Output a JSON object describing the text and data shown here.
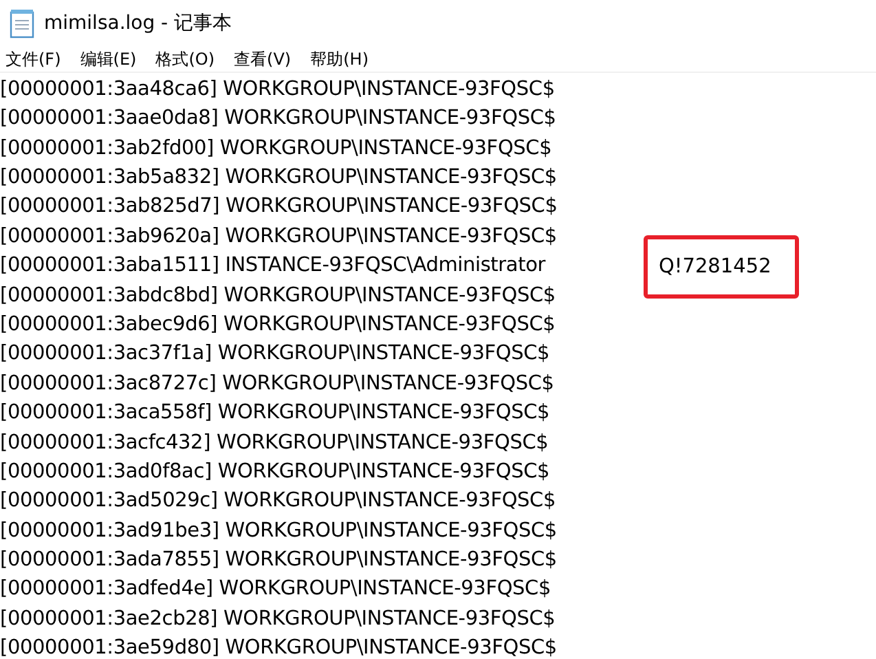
{
  "window": {
    "title": "mimilsa.log - 记事本"
  },
  "menu": [
    "文件(F)",
    "编辑(E)",
    "格式(O)",
    "查看(V)",
    "帮助(H)"
  ],
  "lines": [
    {
      "text": "[00000001:3aa48ca6] WORKGROUP\\INSTANCE-93FQSC$"
    },
    {
      "text": "[00000001:3aae0da8] WORKGROUP\\INSTANCE-93FQSC$"
    },
    {
      "text": "[00000001:3ab2fd00] WORKGROUP\\INSTANCE-93FQSC$"
    },
    {
      "text": "[00000001:3ab5a832] WORKGROUP\\INSTANCE-93FQSC$"
    },
    {
      "text": "[00000001:3ab825d7] WORKGROUP\\INSTANCE-93FQSC$"
    },
    {
      "text": "[00000001:3ab9620a] WORKGROUP\\INSTANCE-93FQSC$"
    },
    {
      "text": "[00000001:3aba1511] INSTANCE-93FQSC\\Administrator",
      "highlighted_note": "Q!7281452"
    },
    {
      "text": "[00000001:3abdc8bd] WORKGROUP\\INSTANCE-93FQSC$"
    },
    {
      "text": "[00000001:3abec9d6] WORKGROUP\\INSTANCE-93FQSC$"
    },
    {
      "text": "[00000001:3ac37f1a] WORKGROUP\\INSTANCE-93FQSC$"
    },
    {
      "text": "[00000001:3ac8727c] WORKGROUP\\INSTANCE-93FQSC$"
    },
    {
      "text": "[00000001:3aca558f] WORKGROUP\\INSTANCE-93FQSC$"
    },
    {
      "text": "[00000001:3acfc432] WORKGROUP\\INSTANCE-93FQSC$"
    },
    {
      "text": "[00000001:3ad0f8ac] WORKGROUP\\INSTANCE-93FQSC$"
    },
    {
      "text": "[00000001:3ad5029c] WORKGROUP\\INSTANCE-93FQSC$"
    },
    {
      "text": "[00000001:3ad91be3] WORKGROUP\\INSTANCE-93FQSC$"
    },
    {
      "text": "[00000001:3ada7855] WORKGROUP\\INSTANCE-93FQSC$"
    },
    {
      "text": "[00000001:3adfed4e] WORKGROUP\\INSTANCE-93FQSC$"
    },
    {
      "text": "[00000001:3ae2cb28] WORKGROUP\\INSTANCE-93FQSC$"
    },
    {
      "text": "[00000001:3ae59d80] WORKGROUP\\INSTANCE-93FQSC$"
    }
  ]
}
